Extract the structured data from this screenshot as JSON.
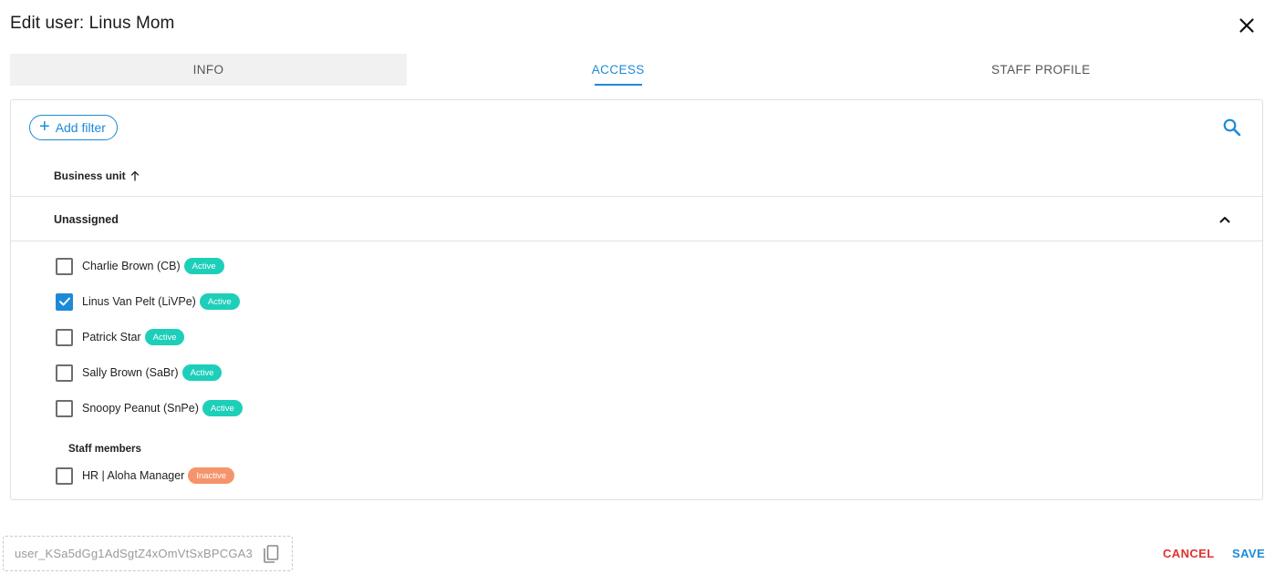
{
  "dialog": {
    "title": "Edit user: Linus Mom"
  },
  "tabs": [
    {
      "label": "INFO",
      "selected": false
    },
    {
      "label": "ACCESS",
      "selected": true
    },
    {
      "label": "STAFF PROFILE",
      "selected": false
    }
  ],
  "filter": {
    "add_label": "Add filter"
  },
  "table": {
    "column_header": "Business unit",
    "sort": "ascending"
  },
  "group": {
    "title": "Unassigned",
    "expanded": true,
    "items": [
      {
        "label": "Charlie Brown (CB)",
        "status": "Active",
        "checked": false
      },
      {
        "label": "Linus Van Pelt (LiVPe)",
        "status": "Active",
        "checked": true
      },
      {
        "label": "Patrick Star",
        "status": "Active",
        "checked": false
      },
      {
        "label": "Sally Brown (SaBr)",
        "status": "Active",
        "checked": false
      },
      {
        "label": "Snoopy Peanut (SnPe)",
        "status": "Active",
        "checked": false
      }
    ],
    "staff_section_label": "Staff members",
    "staff_items": [
      {
        "label": "HR | Aloha Manager",
        "status": "Inactive",
        "checked": false
      }
    ]
  },
  "footer": {
    "user_id": "user_KSa5dGg1AdSgtZ4xOmVtSxBPCGA3",
    "cancel_label": "CANCEL",
    "save_label": "SAVE"
  },
  "colors": {
    "accent": "#1c8ad9",
    "active_badge": "#1dcfb9",
    "inactive_badge": "#f5946b",
    "cancel": "#e0322f"
  },
  "icons": [
    "close-icon",
    "plus-icon",
    "search-icon",
    "arrow-up-icon",
    "chevron-up-icon",
    "check-icon",
    "copy-icon"
  ]
}
